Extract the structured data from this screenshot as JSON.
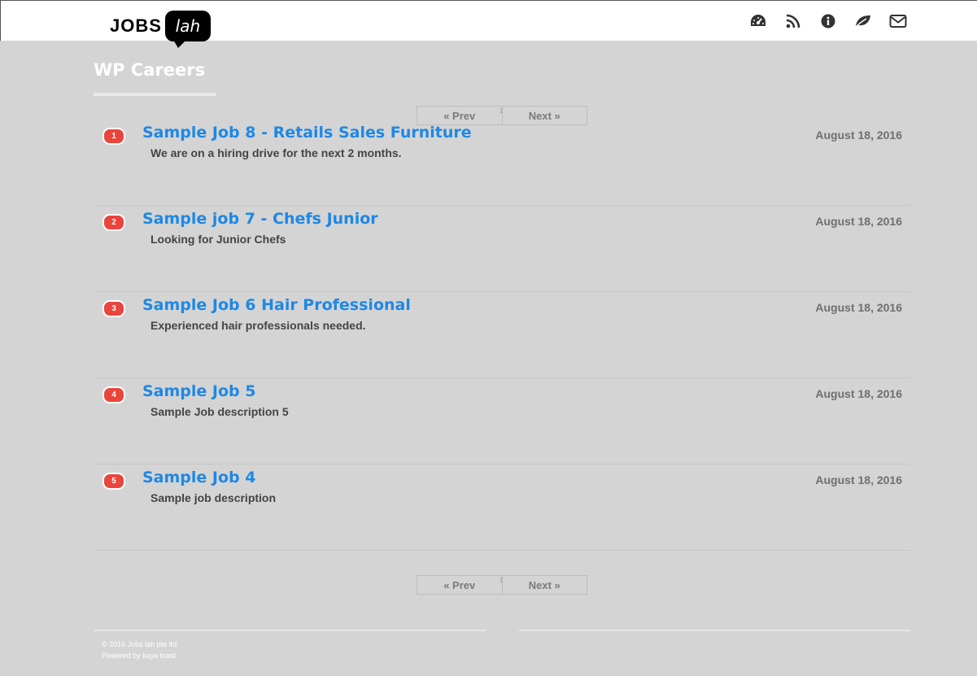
{
  "header": {
    "logo": {
      "word": "JOBS",
      "bubble": "lah"
    },
    "icons": [
      "dashboard-icon",
      "rss-icon",
      "info-icon",
      "leaf-icon",
      "envelope-icon"
    ]
  },
  "page": {
    "title": "WP Careers"
  },
  "pagination": {
    "prev_label": "« Prev",
    "next_label": "Next »",
    "current_page": "1"
  },
  "jobs": [
    {
      "number": "1",
      "title": "Sample Job 8 - Retails Sales Furniture",
      "description": "We are on a hiring drive for the next 2 months.",
      "date": "August 18, 2016"
    },
    {
      "number": "2",
      "title": "Sample job 7 - Chefs Junior",
      "description": "Looking for Junior Chefs",
      "date": "August 18, 2016"
    },
    {
      "number": "3",
      "title": "Sample Job 6 Hair Professional",
      "description": "Experienced hair professionals needed.",
      "date": "August 18, 2016"
    },
    {
      "number": "4",
      "title": "Sample Job 5",
      "description": "Sample Job description 5",
      "date": "August 18, 2016"
    },
    {
      "number": "5",
      "title": "Sample Job 4",
      "description": "Sample job description",
      "date": "August 18, 2016"
    }
  ],
  "footer": {
    "copyright": "© 2015 Jobs lah pte ltd.",
    "powered_by": "Powered by kaya toast."
  }
}
